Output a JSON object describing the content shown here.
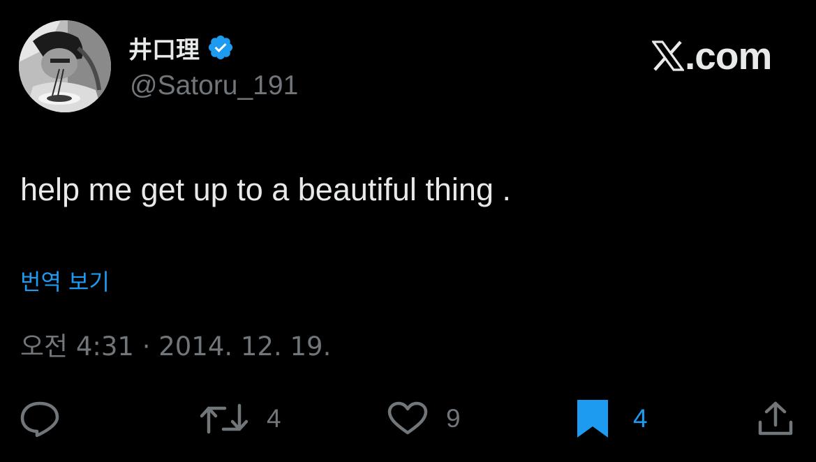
{
  "author": {
    "display_name": "井口理",
    "handle": "@Satoru_191",
    "verified": true,
    "verified_icon": "verified-badge-icon"
  },
  "brand": {
    "x_icon": "x-logo-icon",
    "text": ".com"
  },
  "tweet": {
    "text": "help me get up to a beautiful thing .",
    "translate_label": "번역 보기",
    "timestamp": "오전 4:31 · 2014. 12. 19."
  },
  "actions": {
    "reply": {
      "icon": "reply-icon"
    },
    "retweet": {
      "icon": "retweet-icon",
      "count": "4"
    },
    "like": {
      "icon": "heart-icon",
      "count": "9"
    },
    "bookmark": {
      "icon": "bookmark-filled-icon",
      "count": "4",
      "active": true
    },
    "share": {
      "icon": "share-icon"
    }
  },
  "colors": {
    "background": "#000000",
    "primary_text": "#e7e9ea",
    "secondary_text": "#71767b",
    "accent": "#1d9bf0"
  }
}
